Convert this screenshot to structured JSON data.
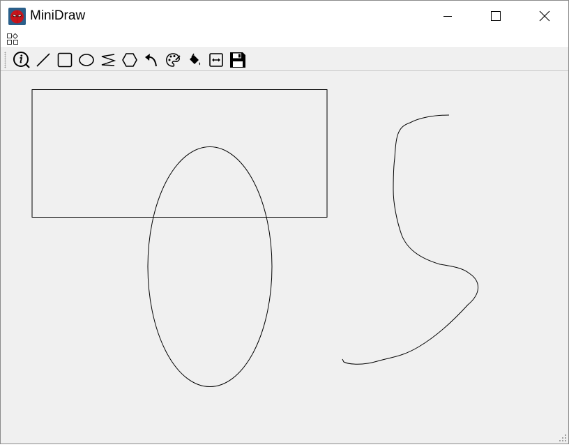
{
  "window": {
    "title": "MiniDraw",
    "controls": [
      "minimize",
      "maximize",
      "close"
    ]
  },
  "menubar": {
    "items": [
      {
        "icon": "menu-grid-icon"
      }
    ]
  },
  "toolbar": {
    "tools": [
      {
        "id": "about",
        "icon": "info-icon"
      },
      {
        "id": "line",
        "icon": "line-icon"
      },
      {
        "id": "rectangle",
        "icon": "rectangle-icon"
      },
      {
        "id": "ellipse",
        "icon": "ellipse-icon"
      },
      {
        "id": "freehand",
        "icon": "freehand-icon"
      },
      {
        "id": "polygon",
        "icon": "polygon-icon"
      },
      {
        "id": "undo",
        "icon": "undo-icon"
      },
      {
        "id": "color",
        "icon": "palette-icon"
      },
      {
        "id": "fill",
        "icon": "fill-bucket-icon"
      },
      {
        "id": "line-width",
        "icon": "width-icon"
      },
      {
        "id": "save",
        "icon": "save-icon"
      }
    ]
  },
  "canvas": {
    "background": "#f0f0f0",
    "stroke": "#000000",
    "shapes": [
      "rectangle",
      "ellipse",
      "freehand"
    ]
  }
}
